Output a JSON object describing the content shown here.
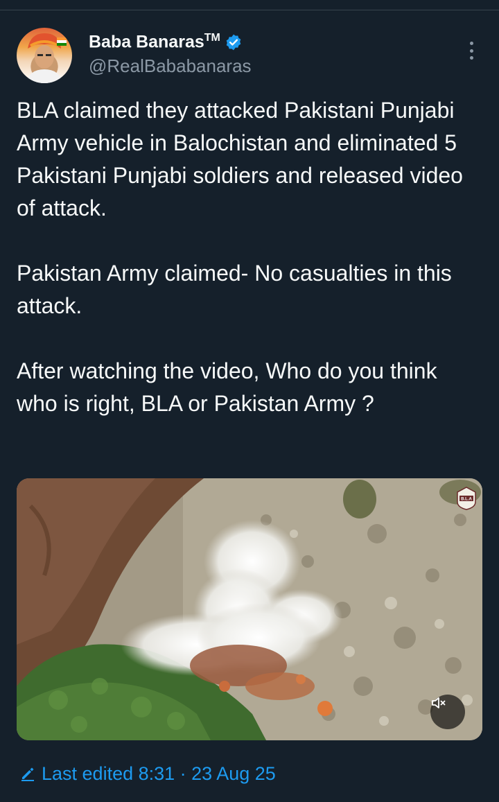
{
  "author": {
    "display_name": "Baba Banaras",
    "trademark": "TM",
    "handle": "@RealBababanaras",
    "verified": true,
    "avatar_icon": "profile-photo"
  },
  "tweet": {
    "paragraphs": [
      "BLA claimed they attacked Pakistani Punjabi Army vehicle in Balochistan and eliminated 5 Pakistani Punjabi soldiers and released video of attack.",
      "Pakistan Army claimed- No casualties in this attack.",
      "After watching the video, Who do you think who is right, BLA or Pakistan Army ?"
    ]
  },
  "media": {
    "type": "video",
    "watermark": "B.L.A",
    "mute_icon": "volume-muted-icon"
  },
  "footer": {
    "edited_text": "Last edited 8:31 · 23 Aug 25"
  },
  "colors": {
    "background": "#15202b",
    "text": "#f7f9f9",
    "secondary": "#8b98a5",
    "accent": "#1d9bf0"
  }
}
